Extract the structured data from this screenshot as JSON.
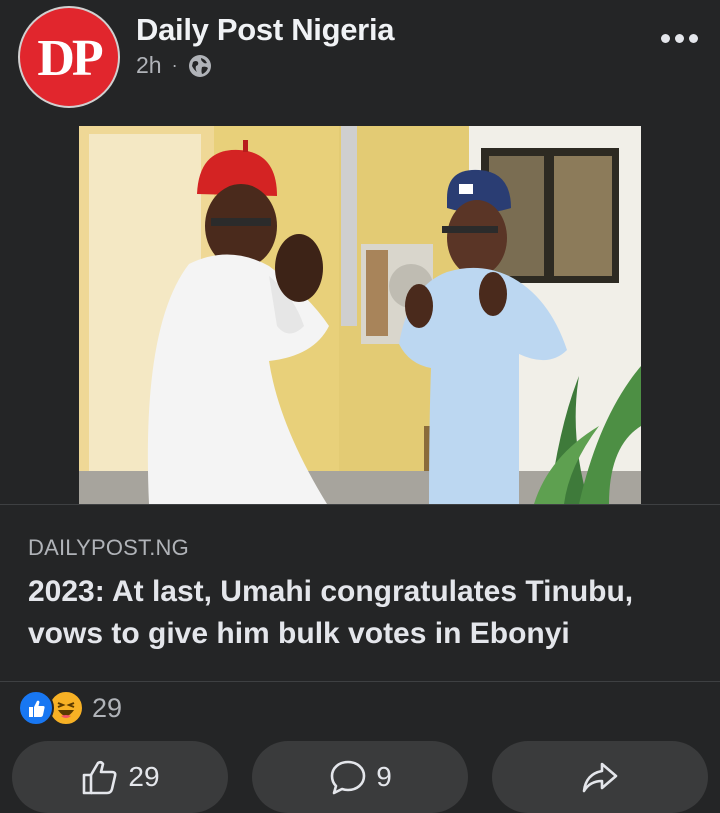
{
  "post": {
    "page_name": "Daily Post Nigeria",
    "avatar_text": "DP",
    "time": "2h",
    "separator": "·",
    "privacy_icon": "globe-icon",
    "menu_icon": "more-horizontal-icon"
  },
  "link": {
    "domain": "DAILYPOST.NG",
    "headline": "2023: At last, Umahi congratulates Tinubu, vows to give him bulk votes in Ebonyi"
  },
  "reactions": {
    "icons": [
      "like-icon",
      "haha-icon"
    ],
    "count": "29"
  },
  "actions": {
    "like_count": "29",
    "comment_count": "9",
    "share_icon": "share-icon"
  },
  "colors": {
    "background": "#242526",
    "button": "#3a3b3c",
    "brand_red": "#e1262d",
    "like_blue": "#1877f2"
  }
}
